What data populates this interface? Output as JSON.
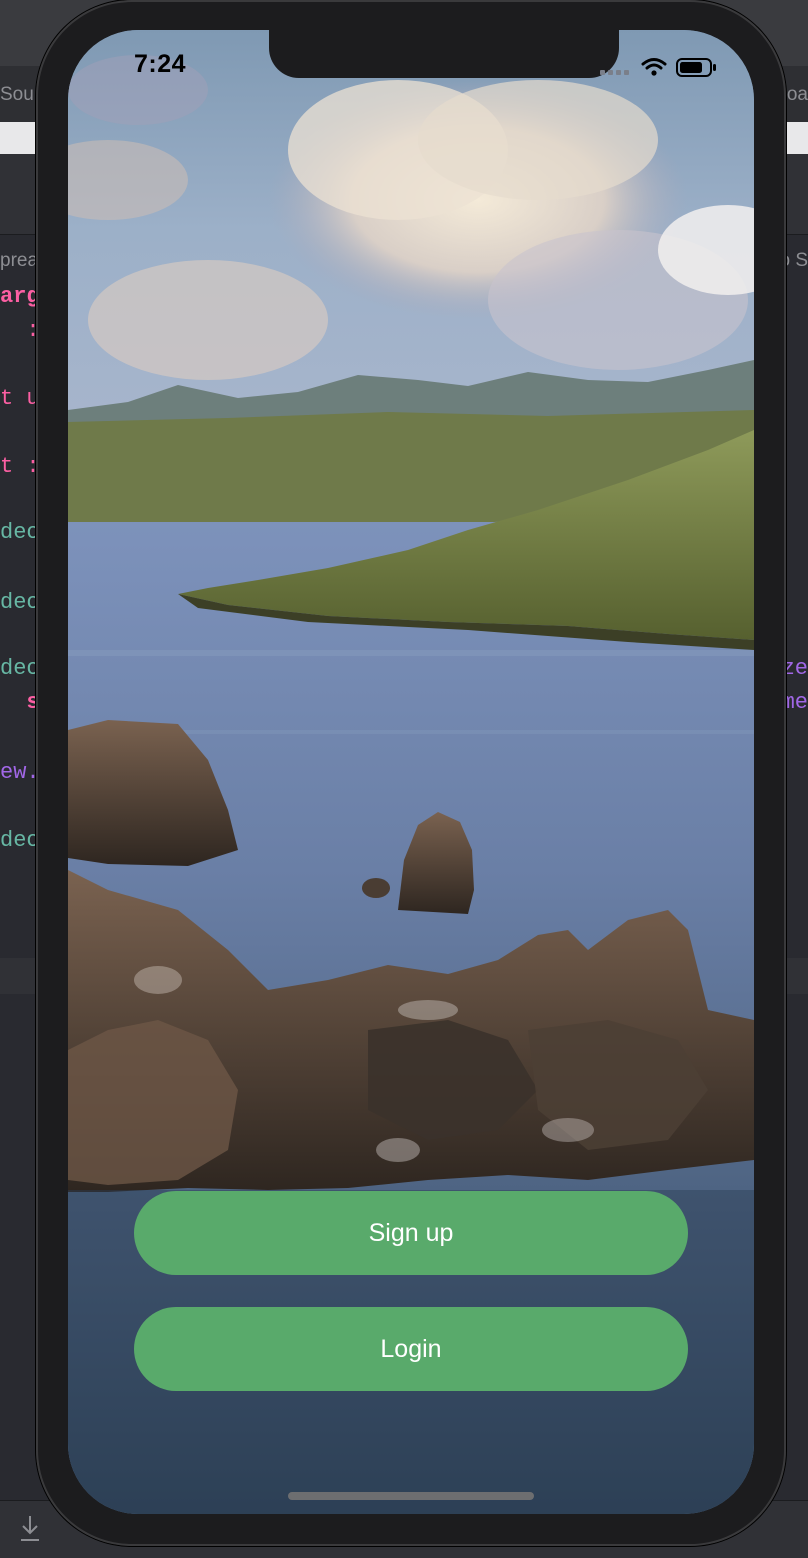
{
  "status_bar": {
    "time": "7:24"
  },
  "buttons": {
    "signup_label": "Sign up",
    "login_label": "Login"
  },
  "ide": {
    "tab_left_text": "Sou",
    "tab_right_text": "oa",
    "breadcrumb_left": "prea",
    "breadcrumb_right": "o S",
    "code_fragments_left": [
      "arg",
      "  :",
      "t u",
      "t :",
      "deo",
      "deo",
      "deo",
      "  s",
      "ew.",
      "deo"
    ],
    "code_fragments_right": [
      "ze",
      "me"
    ]
  },
  "colors": {
    "button_green": "#59aa6b",
    "button_text": "#ffffff",
    "ide_background": "#292a30",
    "phone_bezel": "#1c1c1e"
  },
  "icons": {
    "signal": "cellular-signal-icon",
    "wifi": "wifi-icon",
    "battery": "battery-icon",
    "download": "download-icon"
  }
}
